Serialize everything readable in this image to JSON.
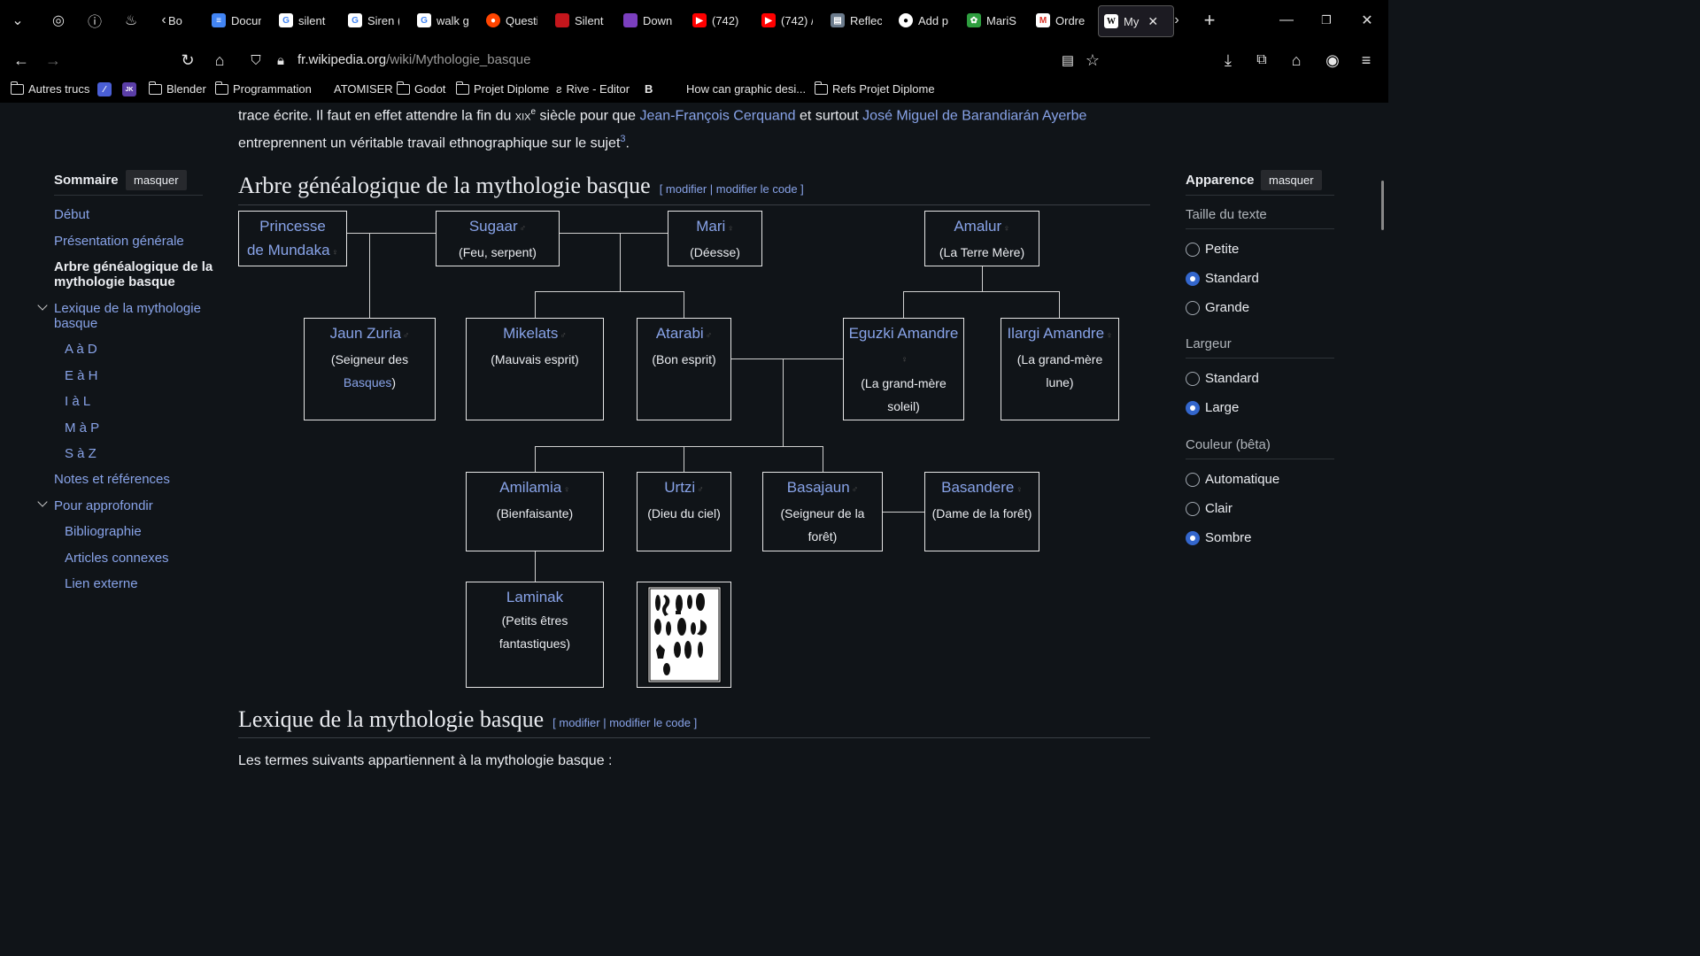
{
  "browser": {
    "tabs": [
      {
        "label": "Bo",
        "icon": "tab-icon"
      },
      {
        "label": "Docun",
        "icon": "docs-icon"
      },
      {
        "label": "silent",
        "icon": "google-icon"
      },
      {
        "label": "Siren (",
        "icon": "google-icon"
      },
      {
        "label": "walk g",
        "icon": "google-icon"
      },
      {
        "label": "Questi",
        "icon": "reddit-icon"
      },
      {
        "label": "Silent",
        "icon": "tab-icon"
      },
      {
        "label": "Down",
        "icon": "tab-icon"
      },
      {
        "label": "(742)",
        "icon": "youtube-icon"
      },
      {
        "label": "(742) /",
        "icon": "youtube-icon"
      },
      {
        "label": "Reflec",
        "icon": "tab-icon"
      },
      {
        "label": "Add p",
        "icon": "github-icon"
      },
      {
        "label": "MariS",
        "icon": "tab-icon"
      },
      {
        "label": "Ordre",
        "icon": "gmail-icon"
      },
      {
        "label": "My",
        "icon": "wikipedia-icon"
      }
    ],
    "url_host": "fr.wikipedia.org",
    "url_path": "/wiki/Mythologie_basque",
    "bookmarks": [
      "Autres trucs",
      "Blender",
      "Programmation",
      "ATOMISER",
      "Godot",
      "Projet Diplome",
      "Rive - Editor",
      "B",
      "How can graphic desi...",
      "Refs Projet Diplome"
    ]
  },
  "article": {
    "intro_part1": "trace écrite. Il faut en effet attendre la fin du ",
    "intro_century": "xix",
    "intro_century_sup": "e",
    "intro_part2": " siècle pour que ",
    "intro_link1": "Jean-François Cerquand",
    "intro_part3": " et surtout ",
    "intro_link2": "José Miguel de Barandiarán Ayerbe",
    "intro_part4": " entreprennent un véritable travail ethnographique sur le sujet",
    "intro_ref": "3",
    "intro_end": ".",
    "section1_title": "Arbre généalogique de la mythologie basque",
    "section2_title": "Lexique de la mythologie basque",
    "edit_open": "[ ",
    "edit_modifier": "modifier",
    "edit_sep": " | ",
    "edit_code": "modifier le code",
    "edit_close": " ]",
    "section2_text": "Les termes suivants appartiennent à la mythologie basque :"
  },
  "toc": {
    "title": "Sommaire",
    "hide": "masquer",
    "items": [
      "Début",
      "Présentation générale",
      "Arbre généalogique de la mythologie basque",
      "Lexique de la mythologie basque",
      "A à D",
      "E à H",
      "I à L",
      "M à P",
      "S à Z",
      "Notes et références",
      "Pour approfondir",
      "Bibliographie",
      "Articles connexes",
      "Lien externe"
    ]
  },
  "appearance": {
    "title": "Apparence",
    "hide": "masquer",
    "text_size_label": "Taille du texte",
    "text_size": [
      "Petite",
      "Standard",
      "Grande"
    ],
    "text_size_selected": "Standard",
    "width_label": "Largeur",
    "width": [
      "Standard",
      "Large"
    ],
    "width_selected": "Large",
    "color_label": "Couleur (bêta)",
    "color": [
      "Automatique",
      "Clair",
      "Sombre"
    ],
    "color_selected": "Sombre"
  },
  "tree": {
    "princess": {
      "name1": "Princesse",
      "name2": "de Mundaka",
      "sym": "♀"
    },
    "sugaar": {
      "name": "Sugaar",
      "sym": "♂",
      "desc": "(Feu, serpent)"
    },
    "mari": {
      "name": "Mari",
      "sym": "♀",
      "desc": "(Déesse)"
    },
    "amalur": {
      "name": "Amalur",
      "sym": "♀",
      "desc": "(La Terre Mère)"
    },
    "jaun": {
      "name": "Jaun Zuria",
      "sym": "♂",
      "desc1": "(Seigneur des",
      "desc_link": "Basques",
      "desc2": ")"
    },
    "mikelats": {
      "name": "Mikelats",
      "sym": "♂",
      "desc": "(Mauvais esprit)"
    },
    "atarabi": {
      "name": "Atarabi",
      "sym": "♂",
      "desc": "(Bon esprit)"
    },
    "eguzki": {
      "name": "Eguzki Amandre",
      "sym": "♀",
      "desc1": "(La grand-mère",
      "desc2": "soleil)"
    },
    "ilargi": {
      "name": "Ilargi Amandre",
      "sym": "♀",
      "desc1": "(La grand-mère",
      "desc2": "lune)"
    },
    "amilamia": {
      "name": "Amilamia",
      "sym": "♀",
      "desc": "(Bienfaisante)"
    },
    "urtzi": {
      "name": "Urtzi",
      "sym": "♂",
      "desc": "(Dieu du ciel)"
    },
    "basajaun": {
      "name": "Basajaun",
      "sym": "♂",
      "desc1": "(Seigneur de la",
      "desc2": "forêt)"
    },
    "basandere": {
      "name": "Basandere",
      "sym": "♀",
      "desc": "(Dame de la forêt)"
    },
    "laminak": {
      "name": "Laminak",
      "desc1": "(Petits êtres",
      "desc2": "fantastiques)"
    }
  }
}
